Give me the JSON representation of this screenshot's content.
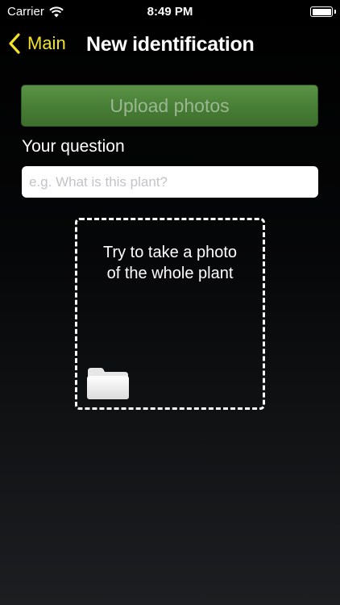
{
  "status_bar": {
    "carrier": "Carrier",
    "time": "8:49 PM",
    "wifi_icon": "wifi-icon",
    "battery_icon": "battery-icon"
  },
  "nav": {
    "back_label": "Main",
    "back_icon": "chevron-left-icon",
    "title": "New identification",
    "accent_color": "#f2e32a"
  },
  "upload": {
    "label": "Upload photos",
    "color": "#4a8038"
  },
  "question": {
    "label": "Your question",
    "placeholder": "e.g. What is this plant?",
    "value": ""
  },
  "photo_area": {
    "hint_line1": "Try to take a photo",
    "hint_line2": "of the whole plant",
    "icon": "folder-icon"
  }
}
